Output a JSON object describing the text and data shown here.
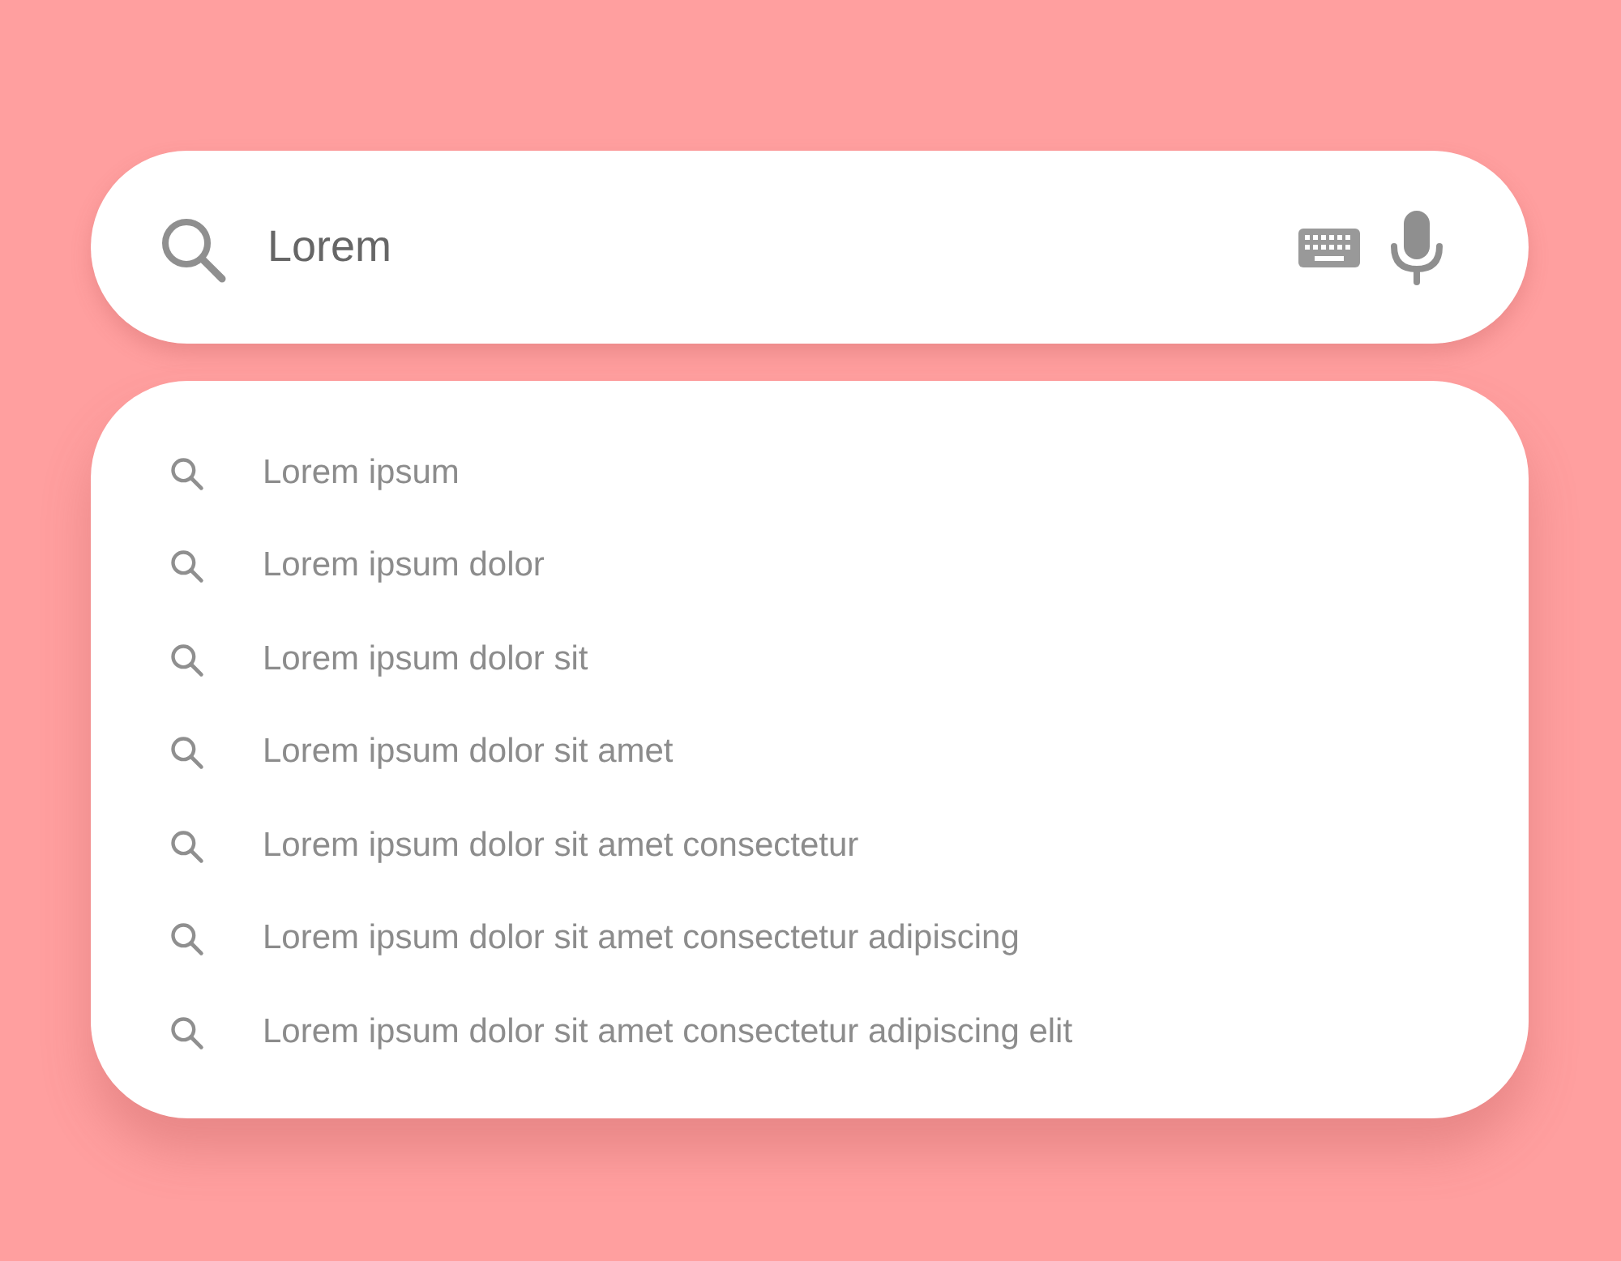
{
  "search": {
    "value": "Lorem"
  },
  "suggestions": [
    {
      "text": "Lorem ipsum"
    },
    {
      "text": "Lorem ipsum dolor"
    },
    {
      "text": "Lorem ipsum dolor sit"
    },
    {
      "text": "Lorem ipsum dolor sit amet"
    },
    {
      "text": "Lorem ipsum dolor sit amet consectetur"
    },
    {
      "text": "Lorem ipsum dolor sit amet consectetur adipiscing"
    },
    {
      "text": "Lorem ipsum dolor sit amet consectetur adipiscing elit"
    }
  ]
}
